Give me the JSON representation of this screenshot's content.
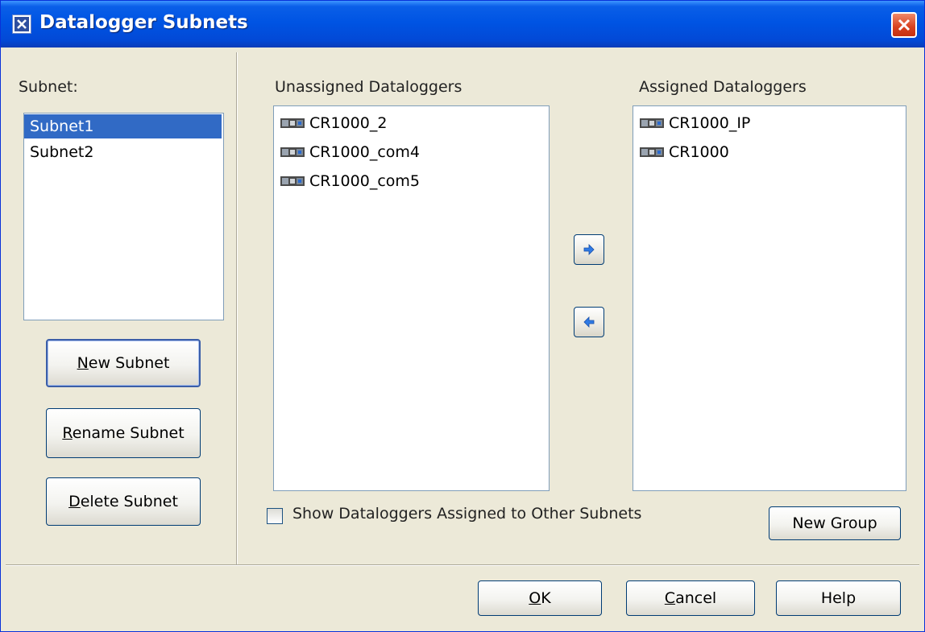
{
  "window": {
    "title": "Datalogger Subnets"
  },
  "subnets": {
    "label": "Subnet:",
    "items": [
      "Subnet1",
      "Subnet2"
    ],
    "selected": "Subnet1"
  },
  "unassigned": {
    "label": "Unassigned Dataloggers",
    "items": [
      "CR1000_2",
      "CR1000_com4",
      "CR1000_com5"
    ]
  },
  "assigned": {
    "label": "Assigned Dataloggers",
    "items": [
      "CR1000_IP",
      "CR1000"
    ]
  },
  "buttons": {
    "new_subnet": {
      "pre": "",
      "key": "N",
      "post": "ew Subnet"
    },
    "rename_subnet": {
      "pre": "",
      "key": "R",
      "post": "ename Subnet"
    },
    "delete_subnet": {
      "pre": "",
      "key": "D",
      "post": "elete Subnet"
    },
    "new_group": "New Group",
    "ok": {
      "pre": "",
      "key": "O",
      "post": "K"
    },
    "cancel": {
      "pre": "",
      "key": "C",
      "post": "ancel"
    },
    "help": "Help"
  },
  "show_other_checkbox": {
    "label": "Show Dataloggers Assigned to Other Subnets",
    "checked": false
  },
  "icons": {
    "title": "app-x-icon",
    "close": "close-x-icon",
    "datalogger": "datalogger-icon",
    "assign": "arrow-right-icon",
    "unassign": "arrow-left-icon"
  },
  "colors": {
    "titlebar": "#0054e3",
    "selection": "#316ac5",
    "dialog_bg": "#ece9d8"
  }
}
